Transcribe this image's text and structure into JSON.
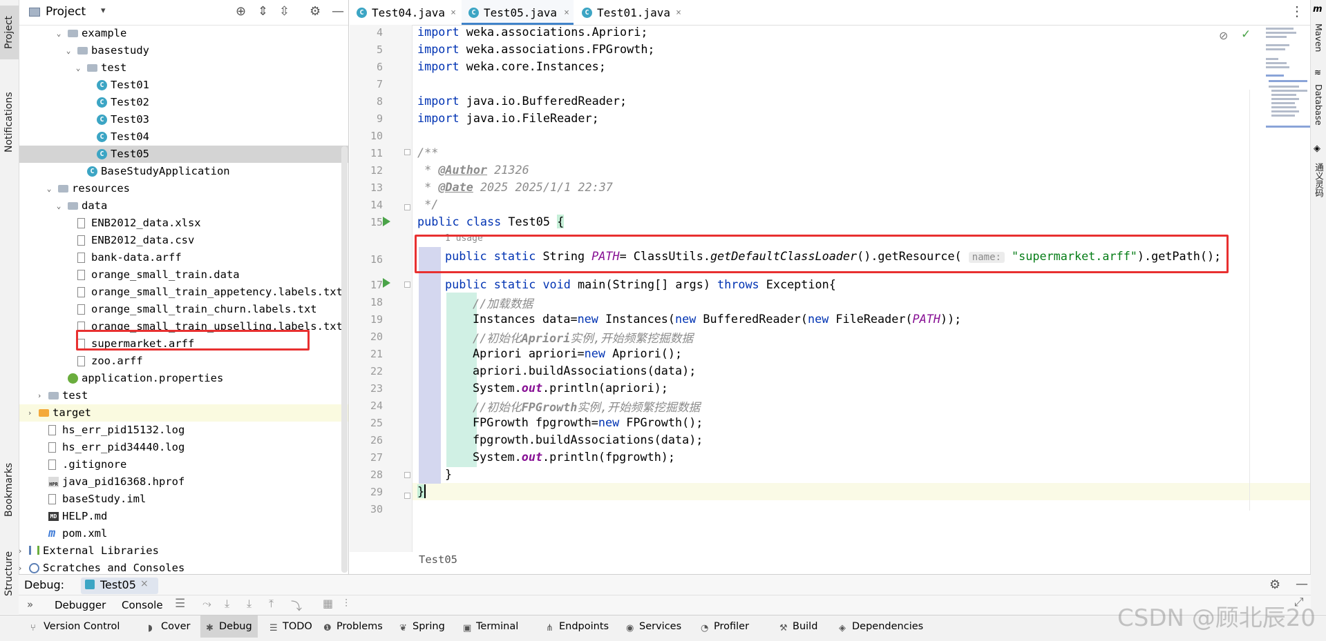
{
  "left_strip": {
    "tabs": [
      "Project",
      "Notifications",
      "Bookmarks",
      "Structure"
    ]
  },
  "right_strip": {
    "tabs": [
      "Maven",
      "Database",
      "通义灵码"
    ]
  },
  "project_panel": {
    "title": "Project",
    "caret": "▾"
  },
  "tree": [
    {
      "label": "example",
      "icon": "folder",
      "arrow": "⌄",
      "depth": 0
    },
    {
      "label": "basestudy",
      "icon": "folder",
      "arrow": "⌄",
      "depth": 1
    },
    {
      "label": "test",
      "icon": "folder",
      "arrow": "⌄",
      "depth": 2
    },
    {
      "label": "Test01",
      "icon": "class",
      "depth": 3
    },
    {
      "label": "Test02",
      "icon": "class",
      "depth": 3
    },
    {
      "label": "Test03",
      "icon": "class",
      "depth": 3
    },
    {
      "label": "Test04",
      "icon": "class",
      "depth": 3
    },
    {
      "label": "Test05",
      "icon": "class",
      "depth": 3,
      "selected": true
    },
    {
      "label": "BaseStudyApplication",
      "icon": "class",
      "depth": 2
    },
    {
      "label": "resources",
      "icon": "folder",
      "arrow": "⌄",
      "depth": -1
    },
    {
      "label": "data",
      "icon": "folder",
      "arrow": "⌄",
      "depth": 0
    },
    {
      "label": "ENB2012_data.xlsx",
      "icon": "file",
      "depth": 1
    },
    {
      "label": "ENB2012_data.csv",
      "icon": "file",
      "depth": 1
    },
    {
      "label": "bank-data.arff",
      "icon": "file",
      "depth": 1
    },
    {
      "label": "orange_small_train.data",
      "icon": "file",
      "depth": 1
    },
    {
      "label": "orange_small_train_appetency.labels.txt",
      "icon": "file",
      "depth": 1
    },
    {
      "label": "orange_small_train_churn.labels.txt",
      "icon": "file",
      "depth": 1
    },
    {
      "label": "orange_small_train_upselling.labels.txt",
      "icon": "file",
      "depth": 1
    },
    {
      "label": "supermarket.arff",
      "icon": "file",
      "depth": 1
    },
    {
      "label": "zoo.arff",
      "icon": "file",
      "depth": 1
    },
    {
      "label": "application.properties",
      "icon": "spring",
      "depth": 0
    },
    {
      "label": "test",
      "icon": "folder",
      "arrow": "›",
      "depth": -2
    },
    {
      "label": "target",
      "icon": "folder-orange",
      "arrow": "›",
      "depth": -3,
      "highlight": true
    },
    {
      "label": "hs_err_pid15132.log",
      "icon": "file",
      "depth": -2
    },
    {
      "label": "hs_err_pid34440.log",
      "icon": "file",
      "depth": -2
    },
    {
      "label": ".gitignore",
      "icon": "file",
      "depth": -2
    },
    {
      "label": "java_pid16368.hprof",
      "icon": "hprof",
      "depth": -2
    },
    {
      "label": "baseStudy.iml",
      "icon": "file",
      "depth": -2
    },
    {
      "label": "HELP.md",
      "icon": "md",
      "depth": -2
    },
    {
      "label": "pom.xml",
      "icon": "m",
      "depth": -2
    },
    {
      "label": "External Libraries",
      "icon": "lib",
      "arrow": "›",
      "depth": -4
    },
    {
      "label": "Scratches and Consoles",
      "icon": "scratch",
      "arrow": "›",
      "depth": -4
    }
  ],
  "tabs": [
    {
      "label": "Test04.java",
      "close": "×"
    },
    {
      "label": "Test05.java",
      "close": "×",
      "active": true
    },
    {
      "label": "Test01.java",
      "close": "×"
    }
  ],
  "code": {
    "line_numbers": [
      "4",
      "5",
      "6",
      "7",
      "8",
      "9",
      "10",
      "11",
      "12",
      "13",
      "14",
      "15",
      "16",
      "17",
      "18",
      "19",
      "20",
      "21",
      "22",
      "23",
      "24",
      "25",
      "26",
      "27",
      "28",
      "29",
      "30"
    ],
    "import1": "weka.associations.Apriori;",
    "import2": "weka.associations.FPGrowth;",
    "import3": "weka.core.Instances;",
    "import4": "java.io.BufferedReader;",
    "import5": "java.io.FileReader;",
    "kw_import": "import",
    "doc_open": "/**",
    "doc_author_tag": "@Author",
    "doc_author_val": " 21326",
    "doc_date_tag": "@Date",
    "doc_date_val": " 2025 2025/1/1 22:37",
    "doc_close": " */",
    "doc_star": " * ",
    "class_decl_kw": "public class",
    "class_name": " Test05 ",
    "brace_open": "{",
    "usage_hint": "1 usage",
    "field_kw": "public static",
    "field_type": " String ",
    "field_name": "PATH",
    "field_eq": "= ClassUtils.",
    "field_call1": "getDefaultClassLoader",
    "field_call1_paren": "().getResource(",
    "param_hint": "name:",
    "field_str": "\"supermarket.arff\"",
    "field_tail": ").getPath();",
    "main_kw": "public static void",
    "main_sig": " main(String[] args) ",
    "main_throws": "throws",
    "main_exc": " Exception{",
    "c_load": "//加载数据",
    "l19_a": "Instances data=",
    "kw_new": "new",
    "l19_b": " Instances(",
    "l19_c": " BufferedReader(",
    "l19_d": " FileReader(",
    "l19_path": "PATH",
    "l19_end": "));",
    "c_apriori_pre": "//初始化",
    "c_apriori_name": "Apriori",
    "c_apriori_post": "实例,开始频繁挖掘数据",
    "l21_a": "Apriori apriori=",
    "l21_b": " Apriori();",
    "l22": "apriori.buildAssociations(data);",
    "sys": "System.",
    "out": "out",
    "l23_end": ".println(apriori);",
    "c_fp_pre": "//初始化",
    "c_fp_name": "FPGrowth",
    "c_fp_post": "实例,开始频繁挖掘数据",
    "l25_a": "FPGrowth fpgrowth=",
    "l25_b": " FPGrowth();",
    "l26": "fpgrowth.buildAssociations(data);",
    "l27_end": ".println(fpgrowth);",
    "brace_close": "}",
    "class_close": "}"
  },
  "breadcrumb": "Test05",
  "debug": {
    "label": "Debug:",
    "session": "Test05",
    "session_close": "×",
    "tool_tabs": [
      "Debugger",
      "Console"
    ],
    "more": "»"
  },
  "status_bar": [
    {
      "label": "Version Control",
      "icon": "branch-icon"
    },
    {
      "label": "Cover",
      "icon": "shield-icon"
    },
    {
      "label": "Debug",
      "icon": "bug-icon",
      "active": true
    },
    {
      "label": "TODO",
      "icon": "list-icon"
    },
    {
      "label": "Problems",
      "icon": "warning-icon"
    },
    {
      "label": "Spring",
      "icon": "leaf-icon"
    },
    {
      "label": "Terminal",
      "icon": "terminal-icon"
    },
    {
      "label": "Endpoints",
      "icon": "endpoints-icon"
    },
    {
      "label": "Services",
      "icon": "services-icon"
    },
    {
      "label": "Profiler",
      "icon": "profiler-icon"
    },
    {
      "label": "Build",
      "icon": "hammer-icon"
    },
    {
      "label": "Dependencies",
      "icon": "layers-icon"
    }
  ],
  "watermark": "CSDN @顾北辰20",
  "colors": {
    "keyword": "#0033b3",
    "string": "#067d17",
    "static_field": "#871094",
    "comment": "#8c8c8c",
    "highlight_box": "#e83030"
  }
}
